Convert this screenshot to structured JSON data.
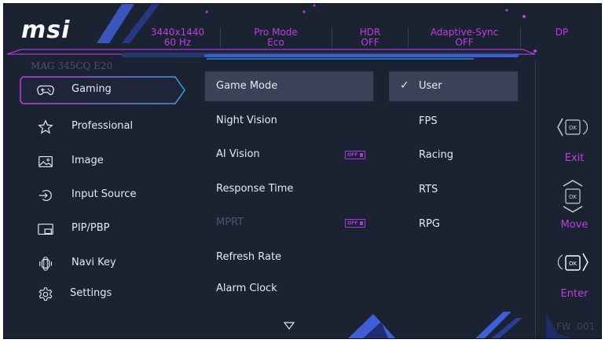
{
  "brand": {
    "logo": "msi"
  },
  "status_bar": [
    {
      "line1": "3440x1440",
      "line2": "60 Hz"
    },
    {
      "line1": "Pro Mode",
      "line2": "Eco"
    },
    {
      "line1": "HDR",
      "line2": "OFF"
    },
    {
      "line1": "Adaptive-Sync",
      "line2": "OFF"
    },
    {
      "line1": "DP",
      "line2": ""
    }
  ],
  "model_name": "MAG 345CQ E20",
  "main_menu": [
    {
      "label": "Gaming",
      "icon": "gamepad-icon",
      "selected": true
    },
    {
      "label": "Professional",
      "icon": "star-icon"
    },
    {
      "label": "Image",
      "icon": "image-icon"
    },
    {
      "label": "Input Source",
      "icon": "input-source-icon"
    },
    {
      "label": "PIP/PBP",
      "icon": "pip-icon"
    },
    {
      "label": "Navi Key",
      "icon": "joystick-icon"
    },
    {
      "label": "Settings",
      "icon": "gear-icon"
    }
  ],
  "sub_menu": [
    {
      "label": "Game Mode",
      "selected": true
    },
    {
      "label": "Night Vision"
    },
    {
      "label": "AI Vision",
      "toggle": "OFF"
    },
    {
      "label": "Response Time"
    },
    {
      "label": "MPRT",
      "toggle": "OFF",
      "disabled": true
    },
    {
      "label": "Refresh Rate"
    },
    {
      "label": "Alarm Clock"
    }
  ],
  "options": [
    {
      "label": "User",
      "selected": true
    },
    {
      "label": "FPS"
    },
    {
      "label": "Racing"
    },
    {
      "label": "RTS"
    },
    {
      "label": "RPG"
    }
  ],
  "nav": {
    "exit": "Exit",
    "move": "Move",
    "enter": "Enter",
    "ok": "OK"
  },
  "firmware": "FW .001",
  "colors": {
    "accent": "#c23de0",
    "background": "#1b2232",
    "selection": "#3a4258",
    "brand_blue": "#3f5fd6"
  }
}
